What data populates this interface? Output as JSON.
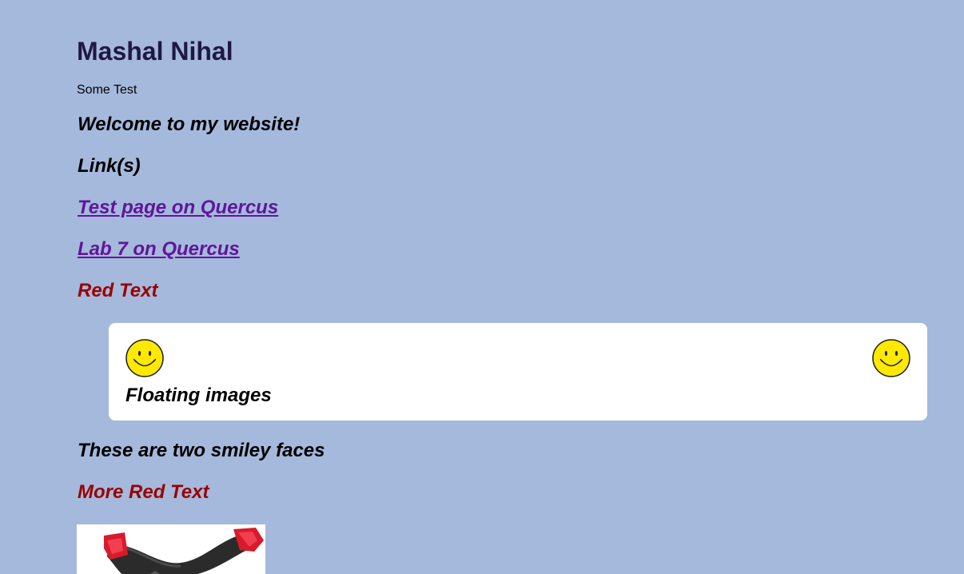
{
  "header": {
    "title": "Mashal Nihal",
    "subtitle": "Some Test"
  },
  "content": {
    "welcome": "Welcome to my website!",
    "links_heading": "Link(s)",
    "links": [
      {
        "label": "Test page on Quercus"
      },
      {
        "label": "Lab 7 on Quercus"
      }
    ],
    "red_text": "Red Text",
    "card": {
      "caption": "Floating images",
      "left_image": "smiley-face-icon",
      "right_image": "smiley-face-icon"
    },
    "smiley_caption": "These are two smiley faces",
    "more_red_text": "More Red Text"
  },
  "colors": {
    "background": "#a5b9dc",
    "title": "#1f1845",
    "link": "#60169a",
    "red": "#990000",
    "card": "#ffffff",
    "smiley_fill": "#ffe900"
  }
}
